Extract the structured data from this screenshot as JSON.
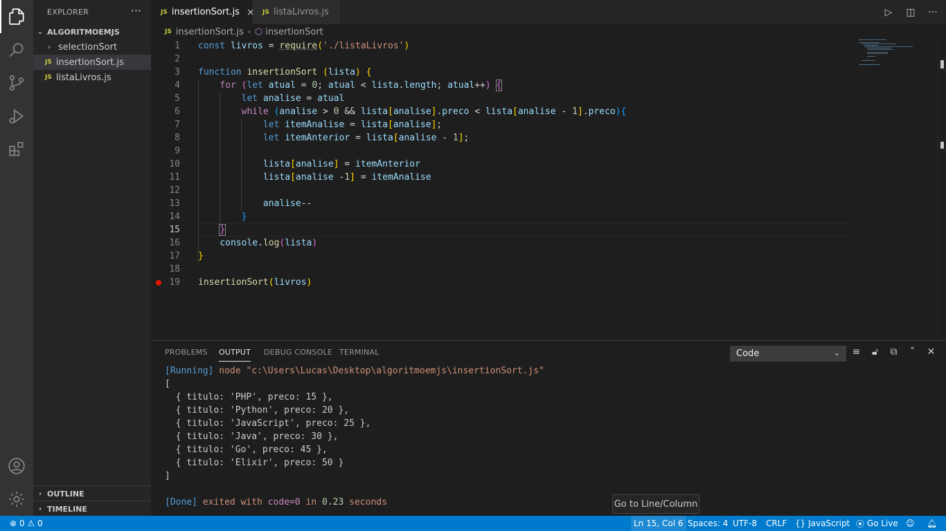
{
  "sidebar": {
    "title": "EXPLORER",
    "more": "···",
    "folder": "ALGORITMOEMJS",
    "items": [
      {
        "label": "selectionSort",
        "type": "folder"
      },
      {
        "label": "insertionSort.js",
        "type": "js",
        "selected": true
      },
      {
        "label": "listaLivros.js",
        "type": "js"
      }
    ],
    "outline": "OUTLINE",
    "timeline": "TIMELINE",
    "js_badge": "JS"
  },
  "tabs": [
    {
      "label": "insertionSort.js",
      "active": true,
      "close": "×"
    },
    {
      "label": "listaLivros.js",
      "active": false
    }
  ],
  "breadcrumb": {
    "file": "insertionSort.js",
    "symbol": "insertionSort"
  },
  "editor": {
    "current_line": 15,
    "breakpoint_line": 19,
    "line_numbers": [
      "1",
      "2",
      "3",
      "4",
      "5",
      "6",
      "7",
      "8",
      "9",
      "10",
      "11",
      "12",
      "13",
      "14",
      "15",
      "16",
      "17",
      "18",
      "19"
    ]
  },
  "panel": {
    "tabs": [
      "PROBLEMS",
      "OUTPUT",
      "DEBUG CONSOLE",
      "TERMINAL"
    ],
    "active_tab": "OUTPUT",
    "select_value": "Code",
    "output": {
      "running_tag": "[Running]",
      "running_cmd": " node \"c:\\Users\\Lucas\\Desktop\\algoritmoemjs\\insertionSort.js\"",
      "open_bracket": "[",
      "rows": [
        "  { titulo: 'PHP', preco: 15 },",
        "  { titulo: 'Python', preco: 20 },",
        "  { titulo: 'JavaScript', preco: 25 },",
        "  { titulo: 'Java', preco: 30 },",
        "  { titulo: 'Go', preco: 45 },",
        "  { titulo: 'Elixir', preco: 50 }"
      ],
      "close_bracket": "]",
      "done_tag": "[Done]",
      "done_text1": " exited with ",
      "done_code": "code=0",
      "done_text2": " in ",
      "done_time": "0.23",
      "done_text3": " seconds"
    }
  },
  "tooltip": "Go to Line/Column",
  "status": {
    "errors": "0",
    "warnings": "0",
    "position": "Ln 15, Col 6",
    "spaces": "Spaces: 4",
    "encoding": "UTF-8",
    "eol": "CRLF",
    "language": "JavaScript",
    "live": "Go Live"
  },
  "colors": {
    "accent": "#007acc",
    "breakpoint": "#e51400",
    "js_badge": "#cbcb41"
  }
}
